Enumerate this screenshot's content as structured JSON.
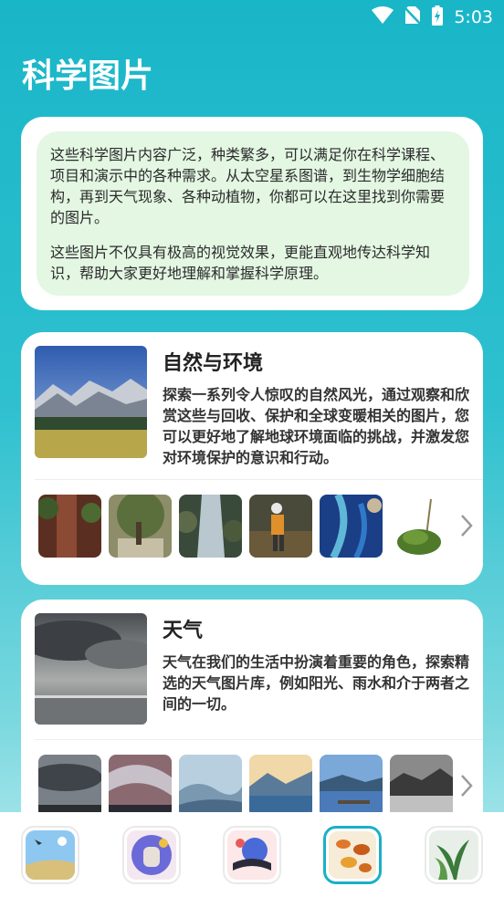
{
  "status_bar": {
    "time": "5:03",
    "icons": [
      "wifi-icon",
      "no-sim-icon",
      "battery-charging-icon"
    ]
  },
  "page": {
    "title": "科学图片"
  },
  "intro": {
    "paragraph1": "这些科学图片内容广泛，种类繁多，可以满足你在科学课程、项目和演示中的各种需求。从太空星系图谱，到生物学细胞结构，再到天气现象、各种动植物，你都可以在这里找到你需要的图片。",
    "paragraph2": "这些图片不仅具有极高的视觉效果，更能直观地传达科学知识，帮助大家更好地理解和掌握科学原理。"
  },
  "sections": [
    {
      "title": "自然与环境",
      "description": "探索一系列令人惊叹的自然风光，通过观察和欣赏这些与回收、保护和全球变暖相关的图片，您可以更好地了解地球环境面临的挑战，并激发您对环境保护的意识和行动。",
      "hero": "mountain-valley-image",
      "thumbnails": [
        "tree-bark-image",
        "tree-grove-image",
        "waterfall-stream-image",
        "researcher-field-image",
        "coral-reef-aerial-image",
        "moss-sprout-image"
      ]
    },
    {
      "title": "天气",
      "description": "天气在我们的生活中扮演着重要的角色，探索精选的天气图片库，例如阳光、雨水和介于两者之间的一切。",
      "hero": "cloudy-sea-image",
      "thumbnails": [
        "dark-clouds-image",
        "storm-sky-image",
        "misty-hills-image",
        "mountain-lake-image",
        "lake-pier-image",
        "bw-landscape-image"
      ]
    }
  ],
  "bottom_nav": {
    "active_index": 3,
    "items": [
      "landscape-tab-icon",
      "hands-tab-icon",
      "books-tab-icon",
      "leaves-tab-icon",
      "plants-tab-icon"
    ]
  },
  "colors": {
    "accent": "#1ab0c7",
    "intro_bg": "#e3f7e3",
    "card_bg": "#ffffff"
  }
}
